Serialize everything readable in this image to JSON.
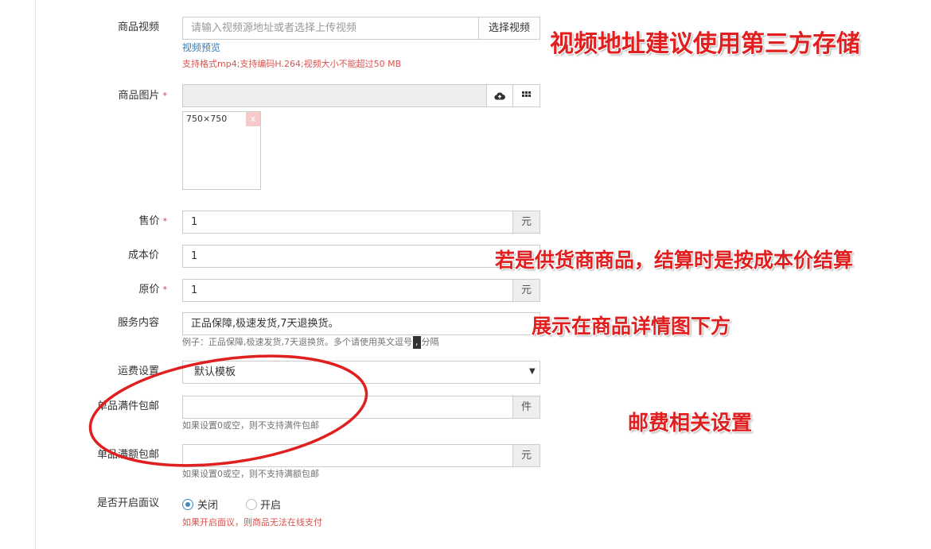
{
  "video": {
    "label": "商品视频",
    "placeholder": "请输入视频源地址或者选择上传视频",
    "select_button": "选择视频",
    "preview_link": "视频预览",
    "help": "支持格式mp4;支持编码H.264;视频大小不能超过50 MB"
  },
  "images": {
    "label": "商品图片",
    "required_mark": "*",
    "thumb_text": "750×750",
    "remove": "x"
  },
  "sale_price": {
    "label": "售价",
    "required_mark": "*",
    "value": "1",
    "unit": "元"
  },
  "cost_price": {
    "label": "成本价",
    "value": "1"
  },
  "original_price": {
    "label": "原价",
    "required_mark": "*",
    "value": "1",
    "unit": "元"
  },
  "service": {
    "label": "服务内容",
    "value": "正品保障,极速发货,7天退换货。",
    "help_prefix": "例子：正品保障,极速发货,7天退换货。多个请使用英文逗号",
    "help_comma": ",",
    "help_suffix": "分隔"
  },
  "shipping": {
    "label": "运费设置",
    "selected": "默认模板"
  },
  "free_by_count": {
    "label": "单品满件包邮",
    "value": "",
    "unit": "件",
    "help": "如果设置0或空，则不支持满件包邮"
  },
  "free_by_amount": {
    "label": "单品满额包邮",
    "value": "",
    "unit": "元",
    "help": "如果设置0或空，则不支持满额包邮"
  },
  "negotiable": {
    "label": "是否开启面议",
    "option_off": "关闭",
    "option_on": "开启",
    "help": "如果开启面议，则商品无法在线支付"
  },
  "annotations": {
    "video_note": "视频地址建议使用第三方存储",
    "cost_note": "若是供货商商品，结算时是按成本价结算",
    "service_note": "展示在商品详情图下方",
    "shipping_note": "邮费相关设置"
  },
  "colors": {
    "annotation": "#e02020",
    "link": "#337ab7",
    "help_red": "#d9534f",
    "radio": "#3c8dbc"
  }
}
